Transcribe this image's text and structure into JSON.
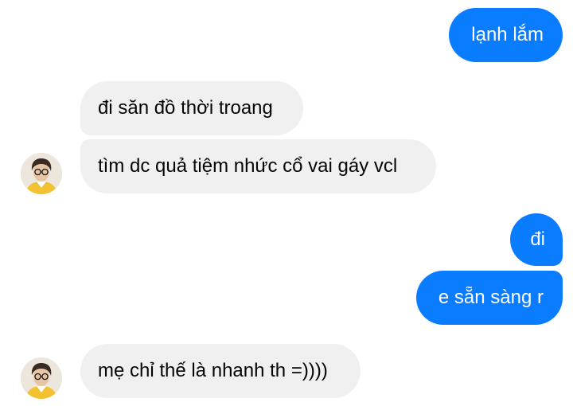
{
  "messages": [
    {
      "id": "m1",
      "direction": "sent",
      "text": "lạnh lắm"
    },
    {
      "id": "m2",
      "direction": "received",
      "text": "đi săn đồ thời troang"
    },
    {
      "id": "m3",
      "direction": "received",
      "text": "tìm dc quả tiệm nhức cổ vai gáy vcl"
    },
    {
      "id": "m4",
      "direction": "sent",
      "text": "đi"
    },
    {
      "id": "m5",
      "direction": "sent",
      "text": "e sẵn sàng r"
    },
    {
      "id": "m6",
      "direction": "received",
      "text": "mẹ chỉ thế là nhanh th =))))"
    }
  ],
  "colors": {
    "sent_bubble": "#0a7cff",
    "sent_text": "#ffffff",
    "received_bubble": "#f0f0f0",
    "received_text": "#050505",
    "background": "#ffffff"
  },
  "avatar": {
    "icon": "contact-avatar-icon"
  }
}
